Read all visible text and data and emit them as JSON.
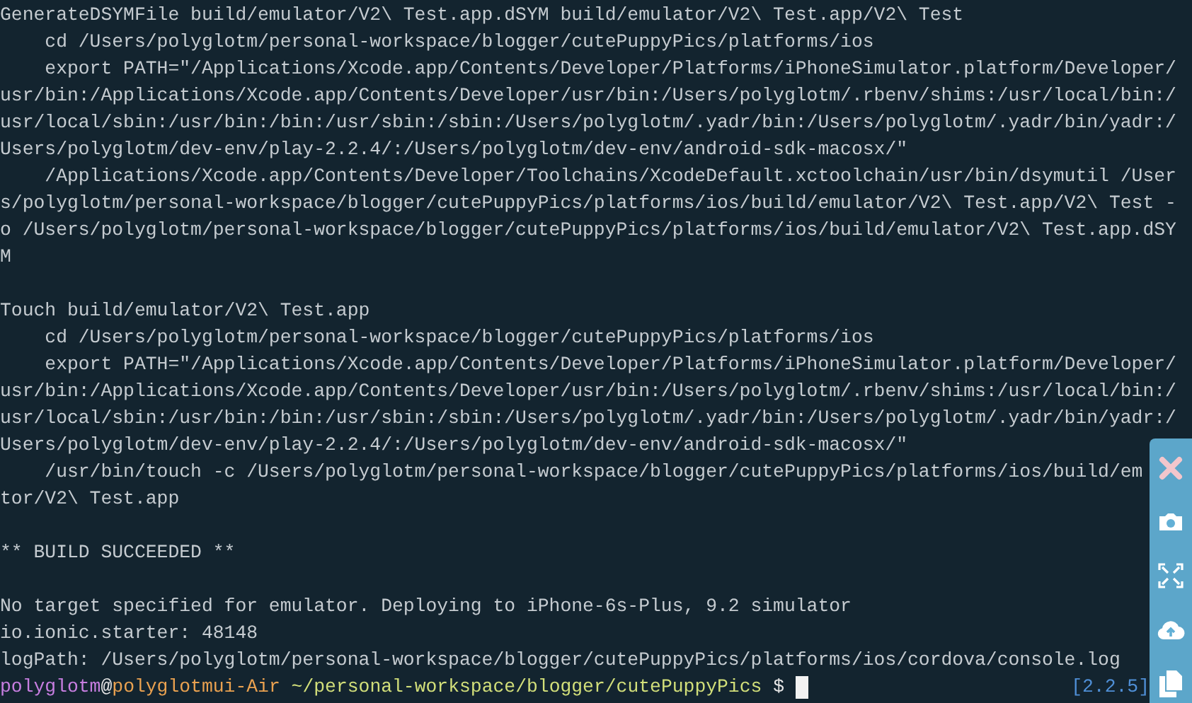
{
  "terminal": {
    "blocks": [
      {
        "lines": [
          "GenerateDSYMFile build/emulator/V2\\ Test.app.dSYM build/emulator/V2\\ Test.app/V2\\ Test",
          "    cd /Users/polyglotm/personal-workspace/blogger/cutePuppyPics/platforms/ios",
          "    export PATH=\"/Applications/Xcode.app/Contents/Developer/Platforms/iPhoneSimulator.platform/Developer/",
          "usr/bin:/Applications/Xcode.app/Contents/Developer/usr/bin:/Users/polyglotm/.rbenv/shims:/usr/local/bin:/",
          "usr/local/sbin:/usr/bin:/bin:/usr/sbin:/sbin:/Users/polyglotm/.yadr/bin:/Users/polyglotm/.yadr/bin/yadr:/",
          "Users/polyglotm/dev-env/play-2.2.4/:/Users/polyglotm/dev-env/android-sdk-macosx/\"",
          "    /Applications/Xcode.app/Contents/Developer/Toolchains/XcodeDefault.xctoolchain/usr/bin/dsymutil /User",
          "s/polyglotm/personal-workspace/blogger/cutePuppyPics/platforms/ios/build/emulator/V2\\ Test.app/V2\\ Test -",
          "o /Users/polyglotm/personal-workspace/blogger/cutePuppyPics/platforms/ios/build/emulator/V2\\ Test.app.dSY",
          "M"
        ]
      },
      {
        "lines": [
          "Touch build/emulator/V2\\ Test.app",
          "    cd /Users/polyglotm/personal-workspace/blogger/cutePuppyPics/platforms/ios",
          "    export PATH=\"/Applications/Xcode.app/Contents/Developer/Platforms/iPhoneSimulator.platform/Developer/",
          "usr/bin:/Applications/Xcode.app/Contents/Developer/usr/bin:/Users/polyglotm/.rbenv/shims:/usr/local/bin:/",
          "usr/local/sbin:/usr/bin:/bin:/usr/sbin:/sbin:/Users/polyglotm/.yadr/bin:/Users/polyglotm/.yadr/bin/yadr:/",
          "Users/polyglotm/dev-env/play-2.2.4/:/Users/polyglotm/dev-env/android-sdk-macosx/\"",
          "    /usr/bin/touch -c /Users/polyglotm/personal-workspace/blogger/cutePuppyPics/platforms/ios/build/em",
          "tor/V2\\ Test.app"
        ]
      },
      {
        "lines": [
          "** BUILD SUCCEEDED **"
        ]
      },
      {
        "lines": [
          "No target specified for emulator. Deploying to iPhone-6s-Plus, 9.2 simulator",
          "io.ionic.starter: 48148",
          "logPath: /Users/polyglotm/personal-workspace/blogger/cutePuppyPics/platforms/ios/cordova/console.log"
        ]
      }
    ],
    "prompt": {
      "user": "polyglotm",
      "at": "@",
      "host": "polyglotmui-Air",
      "path": "~/personal-workspace/blogger/cutePuppyPics",
      "symbol": "$",
      "right_status": "[2.2.5]"
    }
  },
  "side_toolbar": {
    "buttons": [
      {
        "kind": "close"
      },
      {
        "kind": "camera"
      },
      {
        "kind": "expand"
      },
      {
        "kind": "upload"
      },
      {
        "kind": "copy"
      }
    ]
  }
}
